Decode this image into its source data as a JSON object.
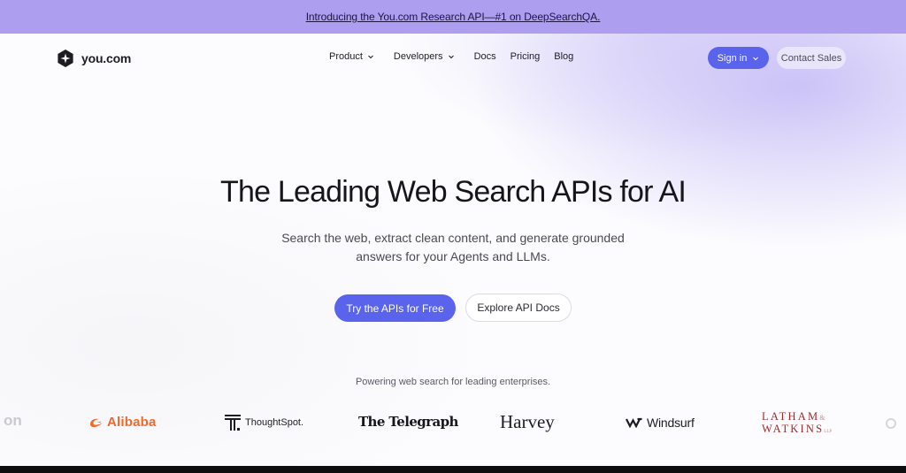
{
  "announcement": {
    "text": "Introducing the You.com Research API—#1 on DeepSearchQA."
  },
  "header": {
    "logo_text": "you.com",
    "nav": [
      {
        "label": "Product",
        "has_dropdown": true
      },
      {
        "label": "Developers",
        "has_dropdown": true
      },
      {
        "label": "Docs",
        "has_dropdown": false
      },
      {
        "label": "Pricing",
        "has_dropdown": false
      },
      {
        "label": "Blog",
        "has_dropdown": false
      }
    ],
    "signin_label": "Sign in",
    "contact_label": "Contact Sales"
  },
  "hero": {
    "title": "The Leading Web Search APIs for AI",
    "subtitle_line1": "Search the web, extract clean content, and generate grounded",
    "subtitle_line2": "answers for your Agents and LLMs.",
    "primary_cta": "Try the APIs for Free",
    "secondary_cta": "Explore API Docs"
  },
  "customers": {
    "heading": "Powering web search for leading enterprises.",
    "logos": [
      {
        "name": "on",
        "icon": "partial-logo"
      },
      {
        "name": "Alibaba",
        "icon": "alibaba-icon"
      },
      {
        "name": "ThoughtSpot.",
        "icon": "thoughtspot-icon"
      },
      {
        "name": "The Telegraph",
        "icon": ""
      },
      {
        "name": "Harvey",
        "icon": ""
      },
      {
        "name": "Windsurf",
        "icon": "windsurf-icon"
      },
      {
        "name_line1": "LATHAM",
        "amp": "&",
        "name_line2": "WATKINS",
        "suffix": "LLP",
        "icon": ""
      }
    ]
  },
  "colors": {
    "announcement_bg": "#ad9ef0",
    "primary": "#5a63ec",
    "alibaba": "#f0692b",
    "latham": "#9b2c2c",
    "footer": "#0d0d0f"
  }
}
